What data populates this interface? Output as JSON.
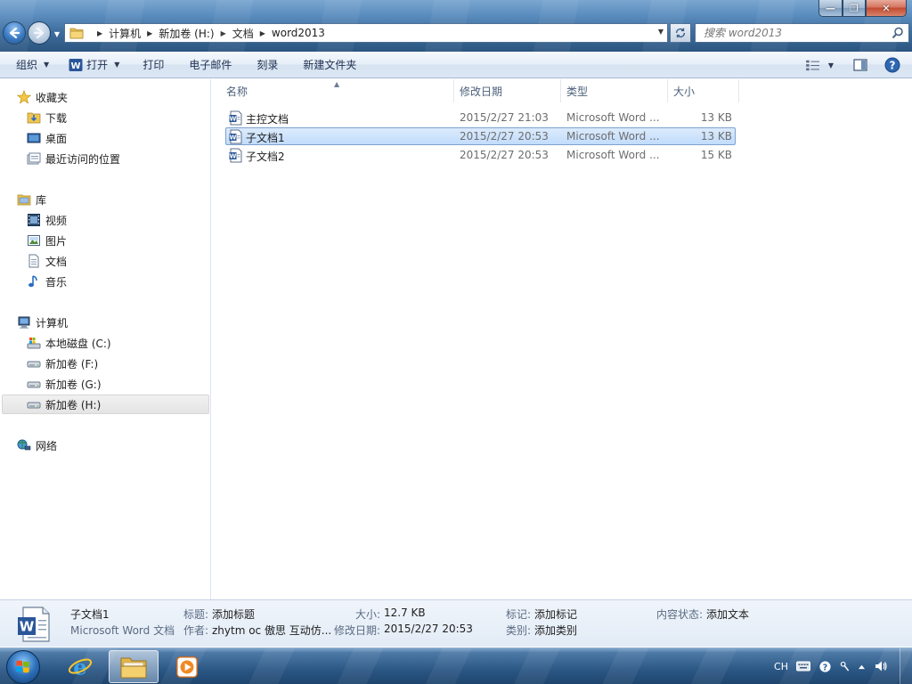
{
  "window": {
    "controls": {
      "minimize": "—",
      "maximize": "❐",
      "close": "✕"
    }
  },
  "address": {
    "crumbs": [
      "计算机",
      "新加卷 (H:)",
      "文档",
      "word2013"
    ],
    "search_placeholder": "搜索 word2013"
  },
  "toolbar": {
    "organize": "组织",
    "open": "打开",
    "print": "打印",
    "email": "电子邮件",
    "burn": "刻录",
    "new_folder": "新建文件夹"
  },
  "navpane": {
    "favorites": {
      "label": "收藏夹",
      "items": [
        "下载",
        "桌面",
        "最近访问的位置"
      ]
    },
    "libraries": {
      "label": "库",
      "items": [
        "视频",
        "图片",
        "文档",
        "音乐"
      ]
    },
    "computer": {
      "label": "计算机",
      "items": [
        "本地磁盘 (C:)",
        "新加卷 (F:)",
        "新加卷 (G:)",
        "新加卷 (H:)"
      ]
    },
    "network": {
      "label": "网络"
    },
    "selected": "新加卷 (H:)"
  },
  "filelist": {
    "columns": [
      "名称",
      "修改日期",
      "类型",
      "大小"
    ],
    "files": [
      {
        "name": "主控文档",
        "modified": "2015/2/27 21:03",
        "type": "Microsoft Word ...",
        "size": "13 KB"
      },
      {
        "name": "子文档1",
        "modified": "2015/2/27 20:53",
        "type": "Microsoft Word ...",
        "size": "13 KB"
      },
      {
        "name": "子文档2",
        "modified": "2015/2/27 20:53",
        "type": "Microsoft Word ...",
        "size": "15 KB"
      }
    ],
    "selected_index": 1
  },
  "details": {
    "file_name": "子文档1",
    "file_type": "Microsoft Word 文档",
    "title_label": "标题:",
    "title_value": "添加标题",
    "author_label": "作者:",
    "author_value": "zhytm oc 傲思   互动仿...",
    "size_label": "大小:",
    "size_value": "12.7 KB",
    "modified_label": "修改日期:",
    "modified_value": "2015/2/27 20:53",
    "tags_label": "标记:",
    "tags_value": "添加标记",
    "category_label": "类别:",
    "category_value": "添加类别",
    "content_status_label": "内容状态:",
    "content_status_value": "添加文本"
  },
  "taskbar": {
    "tray_lang": "CH"
  },
  "colors": {
    "selection_bg": "#cce4fc",
    "selection_border": "#7da2ce",
    "toolbar_text": "#1e3050",
    "meta_text": "#6d6d6d"
  }
}
